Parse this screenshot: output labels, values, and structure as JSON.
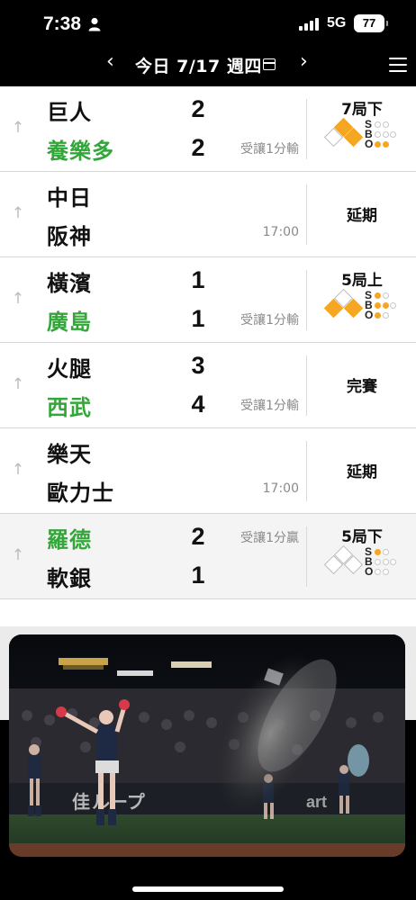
{
  "status_bar": {
    "time": "7:38",
    "network": "5G",
    "battery": "77"
  },
  "nav": {
    "date": "今日 7/17 週四",
    "prev_glyph": "‹",
    "next_glyph": "›"
  },
  "games": [
    {
      "away": "巨人",
      "home": "養樂多",
      "away_score": "2",
      "home_score": "2",
      "away_note": "",
      "home_note": "受讓1分輸",
      "status": "7局下",
      "bases_on": [
        true,
        true,
        false
      ],
      "count": {
        "s": 0,
        "b": 0,
        "o": 2
      },
      "winner": "home"
    },
    {
      "away": "中日",
      "home": "阪神",
      "away_score": "",
      "home_score": "",
      "away_note": "",
      "home_note": "17:00",
      "status": "延期",
      "winner": ""
    },
    {
      "away": "橫濱",
      "home": "廣島",
      "away_score": "1",
      "home_score": "1",
      "away_note": "",
      "home_note": "受讓1分輸",
      "status": "5局上",
      "bases_on": [
        true,
        false,
        true
      ],
      "count": {
        "s": 1,
        "b": 2,
        "o": 1
      },
      "winner": "home"
    },
    {
      "away": "火腿",
      "home": "西武",
      "away_score": "3",
      "home_score": "4",
      "away_note": "",
      "home_note": "受讓1分輸",
      "status": "完賽",
      "winner": "home"
    },
    {
      "away": "樂天",
      "home": "歐力士",
      "away_score": "",
      "home_score": "",
      "away_note": "",
      "home_note": "17:00",
      "status": "延期",
      "winner": ""
    },
    {
      "away": "羅德",
      "home": "軟銀",
      "away_score": "2",
      "home_score": "1",
      "away_note": "受讓1分贏",
      "home_note": "",
      "status": "5局下",
      "bases_on": [
        false,
        false,
        false
      ],
      "count": {
        "s": 1,
        "b": 0,
        "o": 0
      },
      "winner": "away"
    }
  ],
  "sbo_labels": [
    "S",
    "B",
    "O"
  ],
  "colors": {
    "winner_green": "#33a63a",
    "base_on": "#f5a623",
    "background": "#000000"
  },
  "video": {
    "stadium_banner": "ループ",
    "stadium_banner_prefix": "佳",
    "sign_text": "art"
  }
}
